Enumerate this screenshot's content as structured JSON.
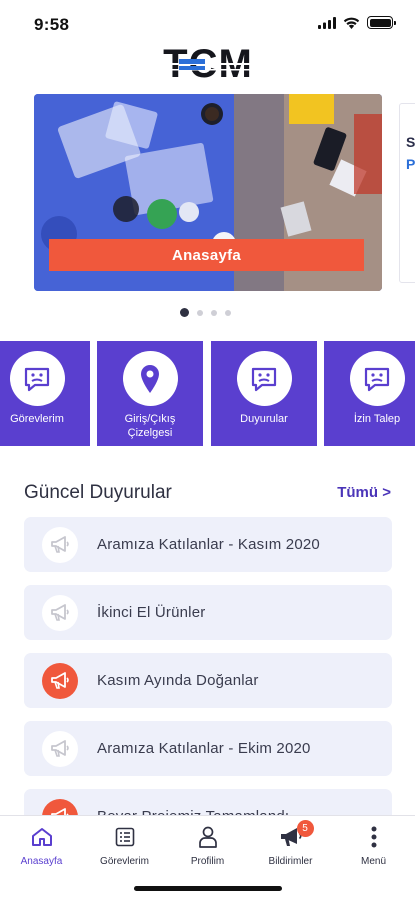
{
  "status_bar": {
    "time": "9:58",
    "icons": [
      "wifi-icon",
      "battery-icon"
    ]
  },
  "logo": {
    "text": "TCM"
  },
  "carousel": {
    "slide_label": "Anasayfa",
    "dots_total": 4,
    "active_index": 0,
    "colors": {
      "button": "#f0583c"
    }
  },
  "quick_actions": [
    {
      "label": "Görevlerim",
      "icon": "message-face-icon"
    },
    {
      "label": "Giriş/Çıkış\nÇizelgesi",
      "icon": "location-pin-icon"
    },
    {
      "label": "Duyurular",
      "icon": "message-face-icon"
    },
    {
      "label": "İzin Talep",
      "icon": "message-face-icon"
    }
  ],
  "announcements_section": {
    "title": "Güncel Duyurular",
    "see_all": "Tümü >"
  },
  "announcements": [
    {
      "title": "Aramıza Katılanlar - Kasım 2020",
      "highlight": false,
      "icon": "megaphone-icon"
    },
    {
      "title": "İkinci El Ürünler",
      "highlight": false,
      "icon": "megaphone-icon"
    },
    {
      "title": "Kasım Ayında Doğanlar",
      "highlight": true,
      "icon": "megaphone-icon"
    },
    {
      "title": "Aramıza Katılanlar - Ekim 2020",
      "highlight": false,
      "icon": "megaphone-icon"
    },
    {
      "title": "Boyar Projemiz Tamamlandı",
      "highlight": true,
      "icon": "megaphone-icon"
    }
  ],
  "tabbar": {
    "items": [
      {
        "label": "Anasayfa",
        "icon": "home-icon",
        "active": true
      },
      {
        "label": "Görevlerim",
        "icon": "task-list-icon",
        "active": false
      },
      {
        "label": "Profilim",
        "icon": "user-icon",
        "active": false
      },
      {
        "label": "Bildirimler",
        "icon": "megaphone-icon",
        "active": false,
        "badge": "5"
      },
      {
        "label": "Menü",
        "icon": "more-vertical-icon",
        "active": false
      }
    ]
  },
  "colors": {
    "primary": "#5a3fcf",
    "accent": "#f0583c",
    "card": "#eef0fa",
    "text": "#2f3142"
  }
}
